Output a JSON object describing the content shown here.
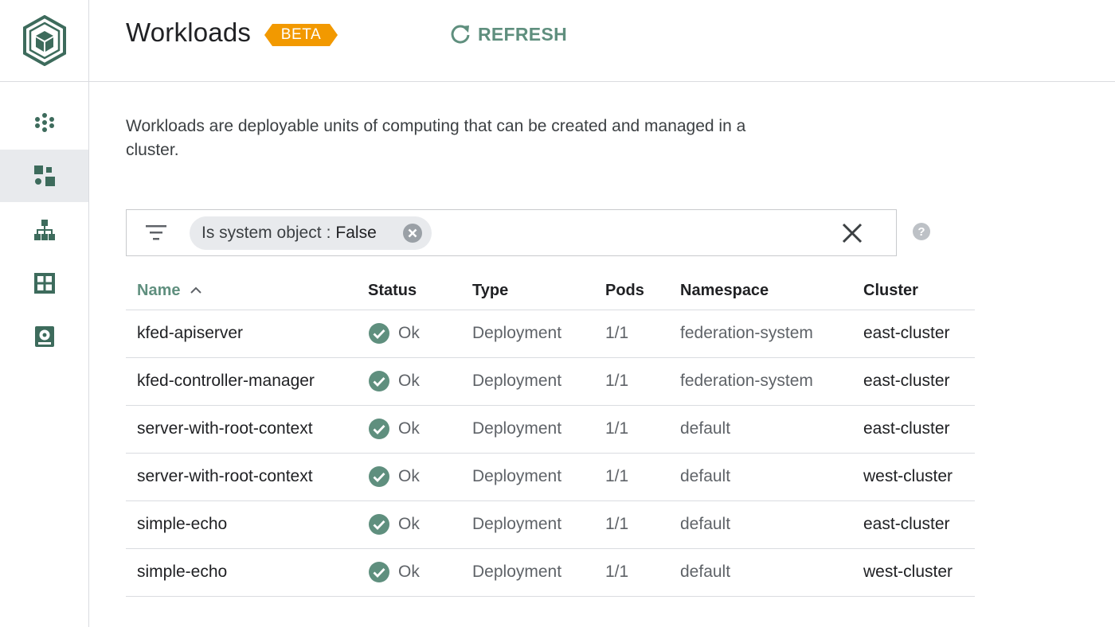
{
  "header": {
    "title": "Workloads",
    "badge": "BETA",
    "refresh_label": "REFRESH"
  },
  "nav": {
    "items": [
      {
        "icon": "clusters-icon",
        "active": false
      },
      {
        "icon": "workloads-icon",
        "active": true
      },
      {
        "icon": "services-icon",
        "active": false
      },
      {
        "icon": "applications-icon",
        "active": false
      },
      {
        "icon": "storage-icon",
        "active": false
      }
    ]
  },
  "description": "Workloads are deployable units of computing that can be created and managed in a cluster.",
  "filter": {
    "chip_key": "Is system object",
    "chip_sep": ":",
    "chip_value": "False"
  },
  "table": {
    "columns": {
      "name": "Name",
      "status": "Status",
      "type": "Type",
      "pods": "Pods",
      "namespace": "Namespace",
      "cluster": "Cluster"
    },
    "sort": {
      "column": "Name",
      "direction": "ascending"
    },
    "rows": [
      {
        "name": "kfed-apiserver",
        "status": "Ok",
        "type": "Deployment",
        "pods": "1/1",
        "namespace": "federation-system",
        "cluster": "east-cluster"
      },
      {
        "name": "kfed-controller-manager",
        "status": "Ok",
        "type": "Deployment",
        "pods": "1/1",
        "namespace": "federation-system",
        "cluster": "east-cluster"
      },
      {
        "name": "server-with-root-context",
        "status": "Ok",
        "type": "Deployment",
        "pods": "1/1",
        "namespace": "default",
        "cluster": "east-cluster"
      },
      {
        "name": "server-with-root-context",
        "status": "Ok",
        "type": "Deployment",
        "pods": "1/1",
        "namespace": "default",
        "cluster": "west-cluster"
      },
      {
        "name": "simple-echo",
        "status": "Ok",
        "type": "Deployment",
        "pods": "1/1",
        "namespace": "default",
        "cluster": "east-cluster"
      },
      {
        "name": "simple-echo",
        "status": "Ok",
        "type": "Deployment",
        "pods": "1/1",
        "namespace": "default",
        "cluster": "west-cluster"
      }
    ]
  },
  "colors": {
    "accent": "#5f8f7e",
    "badge": "#f29900",
    "status_ok": "#5f8f7e",
    "logo": "#3d6b5c"
  }
}
